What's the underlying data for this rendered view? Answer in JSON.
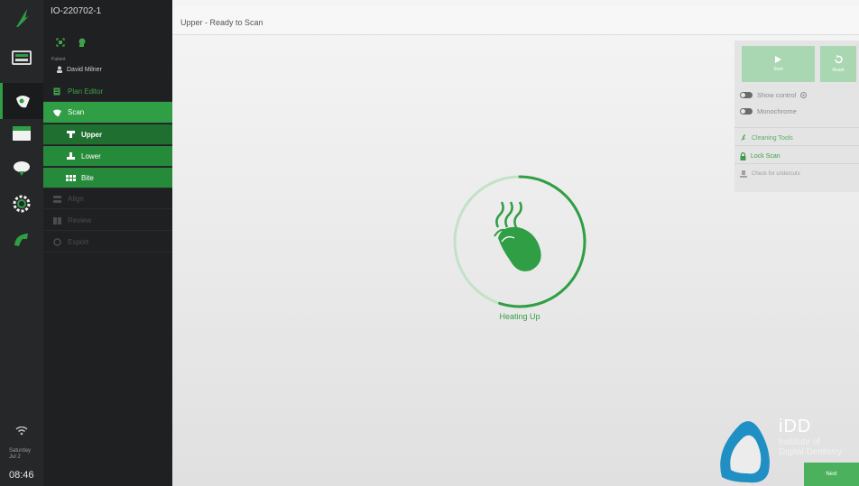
{
  "rail": {
    "items": [
      "app-logo-icon",
      "dashboard-icon",
      "scan-mode-icon",
      "browser-icon",
      "cloud-icon",
      "settings-icon",
      "phone-icon"
    ],
    "day": "Saturday",
    "date": "Jul 2",
    "time": "08:46"
  },
  "sidebar": {
    "case_id": "IO-220702-1",
    "patient_label": "Patient",
    "patient_name": "David Milner",
    "plan_editor": "Plan Editor",
    "scan": "Scan",
    "upper": "Upper",
    "lower": "Lower",
    "bite": "Bite",
    "align": "Align",
    "review": "Review",
    "export": "Export"
  },
  "main": {
    "status": "Upper - Ready to Scan",
    "heating_label": "Heating Up",
    "progress": 0.55
  },
  "panel": {
    "start_label": "Start",
    "reset_label": "Reset",
    "show_control": "Show control",
    "monochrome": "Monochrome",
    "cleaning_tools": "Cleaning Tools",
    "lock_scan": "Lock Scan",
    "check_undercuts": "Check for undercuts"
  },
  "footer": {
    "next_label": "Next"
  },
  "logo": {
    "abbr": "iDD",
    "line1": "Institute of",
    "line2": "Digital Dentistry"
  },
  "colors": {
    "accent": "#2f9e44",
    "accent_dark": "#1f6f30",
    "button_soft": "#a9d7b2",
    "sidebar_bg": "#1f2022",
    "rail_bg": "#262729"
  }
}
